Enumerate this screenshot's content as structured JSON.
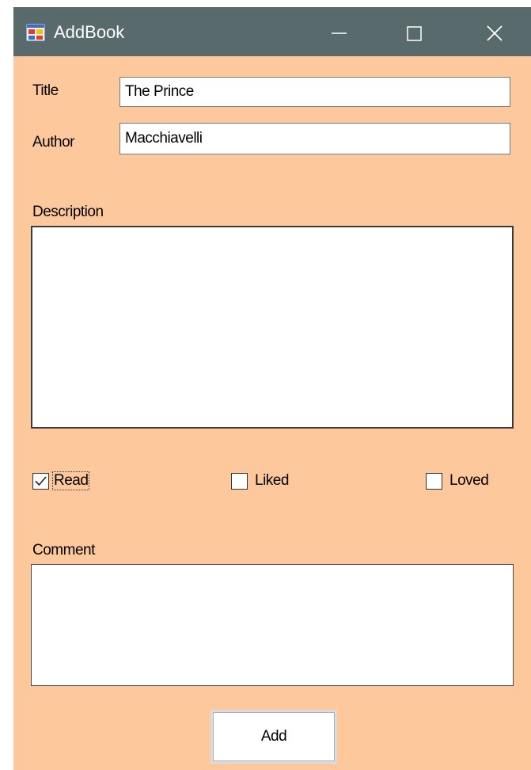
{
  "window": {
    "title": "AddBook"
  },
  "form": {
    "title_label": "Title",
    "title_value": "The Prince",
    "author_label": "Author",
    "author_value": "Macchiavelli",
    "description_label": "Description",
    "description_value": "",
    "comment_label": "Comment",
    "comment_value": ""
  },
  "checkboxes": {
    "read": {
      "label": "Read",
      "checked": true
    },
    "liked": {
      "label": "Liked",
      "checked": false
    },
    "loved": {
      "label": "Loved",
      "checked": false
    }
  },
  "buttons": {
    "add_label": "Add"
  },
  "colors": {
    "background": "#fdc89b",
    "titlebar": "#596a6c"
  },
  "icons": [
    "app-icon",
    "minimize-icon",
    "maximize-icon",
    "close-icon",
    "checkmark-icon"
  ]
}
